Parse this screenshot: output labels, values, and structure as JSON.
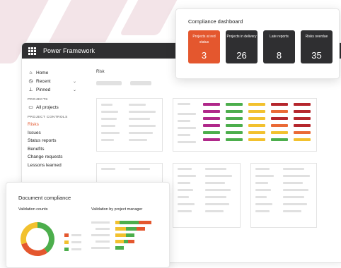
{
  "app": {
    "title": "Power Framework"
  },
  "sidebar": {
    "items": [
      {
        "label": "Home",
        "icon": "home-icon"
      },
      {
        "label": "Recent",
        "icon": "clock-icon"
      },
      {
        "label": "Pinned",
        "icon": "pin-icon"
      }
    ],
    "projects_heading": "PROJECTS",
    "all_projects": "All projects",
    "controls_heading": "PROJECT CONTROLS",
    "controls": [
      "Risks",
      "Issues",
      "Status reports",
      "Benefits",
      "Change requests",
      "Lessons learned"
    ]
  },
  "main": {
    "heading": "Risk"
  },
  "compliance_dashboard": {
    "title": "Compliance dashboard",
    "tiles": [
      {
        "label": "Projects at red status",
        "value": "3",
        "color": "#e4572e"
      },
      {
        "label": "Projects in delivery",
        "value": "26",
        "color": "#2f2f31"
      },
      {
        "label": "Late reports",
        "value": "8",
        "color": "#2f2f31"
      },
      {
        "label": "Risks overdue",
        "value": "35",
        "color": "#2f2f31"
      }
    ]
  },
  "document_compliance": {
    "title": "Document compliance",
    "validation_counts": "Validation counts",
    "validation_by_pm": "Validation by project manager"
  },
  "colors": {
    "accent": "#e4572e",
    "green": "#4cae4c",
    "yellow": "#f2c12e",
    "red": "#b5272d",
    "magenta": "#b0288a",
    "orange": "#ea6a36"
  },
  "chart_data": [
    {
      "type": "pie",
      "values": [
        40,
        30,
        30
      ],
      "colors": [
        "#4cae4c",
        "#e4572e",
        "#f2c12e"
      ]
    },
    {
      "type": "bar",
      "stacked": true,
      "series": [
        {
          "color": "#f2c12e",
          "values": [
            0.1,
            0.25,
            0.25,
            0.2,
            0
          ]
        },
        {
          "color": "#4cae4c",
          "values": [
            0.45,
            0.25,
            0.2,
            0.1,
            0.2
          ]
        },
        {
          "color": "#e4572e",
          "values": [
            0.3,
            0.2,
            0,
            0.15,
            0
          ]
        }
      ]
    }
  ]
}
